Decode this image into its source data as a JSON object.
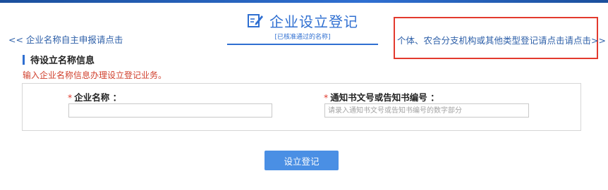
{
  "header": {
    "title": "企业设立登记",
    "subtitle": "[已核准通过的名称]",
    "icon": "edit-form-icon",
    "accent_color": "#2f6fd1"
  },
  "nav": {
    "left_link": "<< 企业名称自主申报请点击",
    "right_link": "个体、农合分支机构或其他类型登记请点击请点击>>"
  },
  "section": {
    "title": "待设立名称信息",
    "hint": "输入企业名称信息办理设立登记业务。"
  },
  "form": {
    "required_mark": "*",
    "company_name": {
      "label": "企业名称 ：",
      "value": "",
      "placeholder": ""
    },
    "notice_number": {
      "label": "通知书文号或告知书编号 ：",
      "value": "",
      "placeholder": "请录入通知书文号或告知书编号的数字部分"
    }
  },
  "actions": {
    "submit_label": "设立登记"
  },
  "colors": {
    "highlight_border": "#e33a2e",
    "hint_text": "#d0402d",
    "button_bg": "#4a8fe4"
  }
}
